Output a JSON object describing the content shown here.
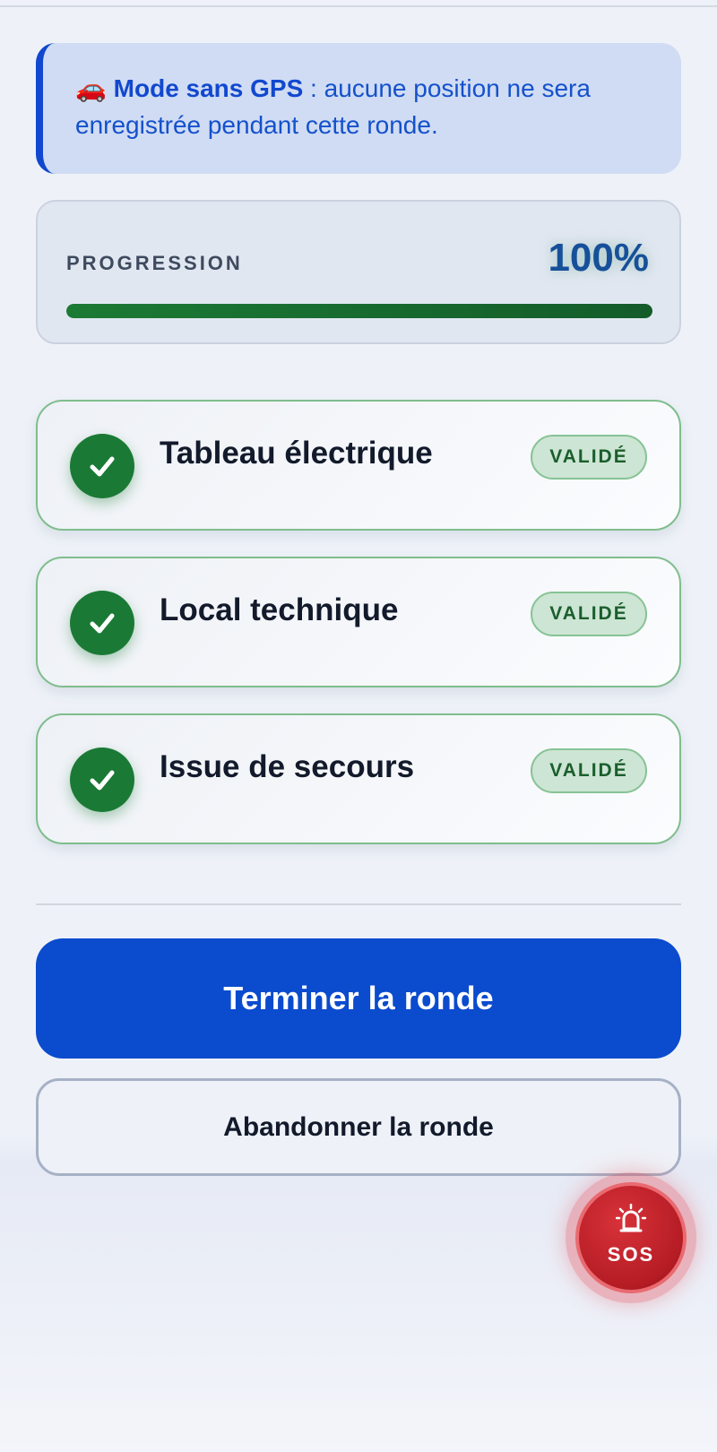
{
  "gps_notice": {
    "icon": "🚗",
    "bold": "Mode sans GPS",
    "text": " : aucune position ne sera enregistrée pendant cette ronde."
  },
  "progress": {
    "label": "PROGRESSION",
    "value_text": "100%",
    "value": 1.0
  },
  "checkpoints": [
    {
      "name": "Tableau électrique",
      "status": "VALIDÉ"
    },
    {
      "name": "Local technique",
      "status": "VALIDÉ"
    },
    {
      "name": "Issue de secours",
      "status": "VALIDÉ"
    }
  ],
  "actions": {
    "finish_label": "Terminer la ronde",
    "abandon_label": "Abandonner la ronde"
  },
  "sos": {
    "label": "SOS",
    "icon": "alarm-siren-icon"
  },
  "colors": {
    "primary": "#0b4bce",
    "success": "#1a7a35",
    "danger": "#b51c24"
  }
}
